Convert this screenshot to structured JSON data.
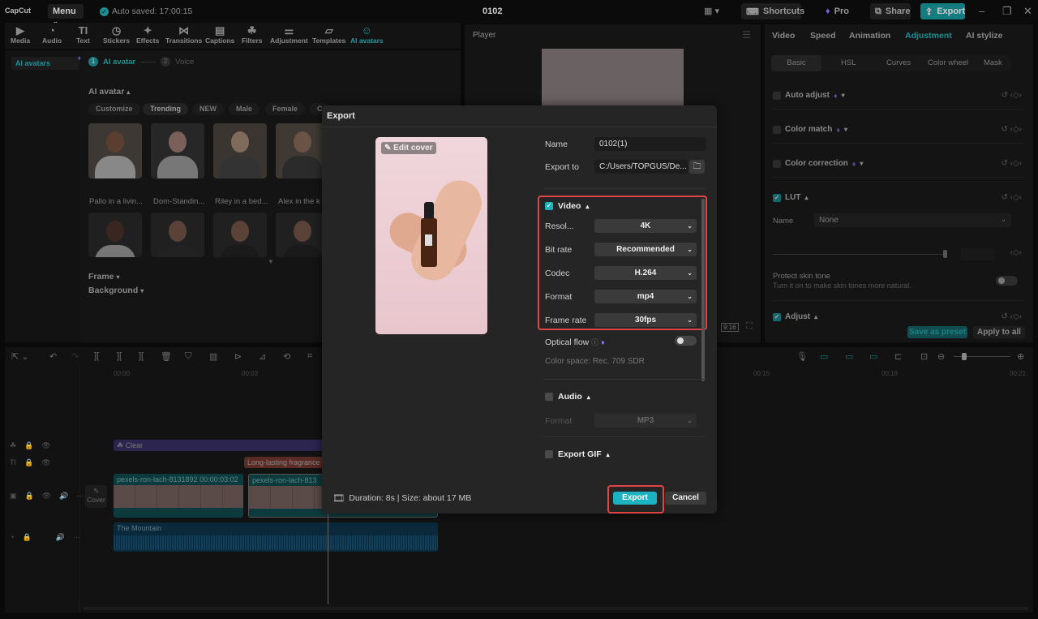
{
  "titlebar": {
    "app_name": "CapCut",
    "menu_label": "Menu",
    "autosave": "Auto saved: 17:00:15",
    "project_title": "0102",
    "shortcuts_label": "Shortcuts",
    "pro_label": "Pro",
    "share_label": "Share",
    "export_label": "Export"
  },
  "tools": [
    {
      "label": "Media",
      "icon": "media-icon",
      "glyph": "▶"
    },
    {
      "label": "Audio",
      "icon": "audio-icon",
      "glyph": "◔"
    },
    {
      "label": "Text",
      "icon": "text-icon",
      "glyph": "TI"
    },
    {
      "label": "Stickers",
      "icon": "stickers-icon",
      "glyph": "◷"
    },
    {
      "label": "Effects",
      "icon": "effects-icon",
      "glyph": "✦"
    },
    {
      "label": "Transitions",
      "icon": "transitions-icon",
      "glyph": "⋈"
    },
    {
      "label": "Captions",
      "icon": "captions-icon",
      "glyph": "▤"
    },
    {
      "label": "Filters",
      "icon": "filters-icon",
      "glyph": "☘"
    },
    {
      "label": "Adjustment",
      "icon": "adjustment-icon",
      "glyph": "⚌"
    },
    {
      "label": "Templates",
      "icon": "templates-icon",
      "glyph": "▱"
    },
    {
      "label": "AI avatars",
      "icon": "ai-avatars-icon",
      "glyph": "☺"
    }
  ],
  "left_panel": {
    "sidebar_item": "AI avatars",
    "step1": {
      "num": "1",
      "label": "AI avatar"
    },
    "step2": {
      "num": "2",
      "label": "Voice"
    },
    "section_title": "AI avatar",
    "chips": [
      "Customize",
      "Trending",
      "NEW",
      "Male",
      "Female",
      "C"
    ],
    "avatars": [
      "Pallo in a livin...",
      "Dom-Standin...",
      "Riley in a bed...",
      "Alex in the k"
    ],
    "frame_label": "Frame",
    "background_label": "Background"
  },
  "player": {
    "title": "Player",
    "ratio": "9:16"
  },
  "right_panel": {
    "tabs": [
      "Video",
      "Speed",
      "Animation",
      "Adjustment",
      "AI stylize"
    ],
    "active_tab": "Adjustment",
    "subtabs": [
      "Basic",
      "HSL",
      "Curves",
      "Color wheel",
      "Mask"
    ],
    "rows": [
      {
        "label": "Auto adjust",
        "checked": false
      },
      {
        "label": "Color match",
        "checked": false
      },
      {
        "label": "Color correction",
        "checked": false
      },
      {
        "label": "LUT",
        "checked": true
      }
    ],
    "lut_name_label": "Name",
    "lut_name_value": "None",
    "protect_title": "Protect skin tone",
    "protect_desc": "Turn it on to make skin tones more natural.",
    "adjust_label": "Adjust",
    "save_preset": "Save as preset",
    "apply_all": "Apply to all"
  },
  "timeline": {
    "ruler": [
      "00:00",
      "00:03",
      "00:15",
      "00:18",
      "00:21"
    ],
    "effect_clip": "Clear",
    "text_clip": "Long-lasting fragrance",
    "video_clip1": "pexels-ron-lach-8131892",
    "video_clip1_time": "00:00:03:02",
    "video_clip2": "pexels-ron-lach-813",
    "cover_label": "Cover",
    "audio_clip": "The Mountain"
  },
  "export_dialog": {
    "title": "Export",
    "edit_cover": "Edit cover",
    "name_label": "Name",
    "name_value": "0102(1)",
    "export_to_label": "Export to",
    "export_to_value": "C:/Users/TOPGUS/De...",
    "video_section": "Video",
    "video_checked": true,
    "fields": [
      {
        "label": "Resol...",
        "value": "4K"
      },
      {
        "label": "Bit rate",
        "value": "Recommended"
      },
      {
        "label": "Codec",
        "value": "H.264"
      },
      {
        "label": "Format",
        "value": "mp4"
      },
      {
        "label": "Frame rate",
        "value": "30fps"
      }
    ],
    "optical_flow": "Optical flow",
    "optical_flow_on": false,
    "color_space": "Color space: Rec. 709 SDR",
    "audio_section": "Audio",
    "audio_checked": false,
    "audio_format_label": "Format",
    "audio_format_value": "MP3",
    "gif_section": "Export GIF",
    "gif_checked": false,
    "footer_info": "Duration: 8s | Size: about 17 MB",
    "export_button": "Export",
    "cancel_button": "Cancel"
  },
  "colors": {
    "accent": "#1bb3c2",
    "highlight_box": "#e04545",
    "pro_gem": "#7b61d9"
  }
}
